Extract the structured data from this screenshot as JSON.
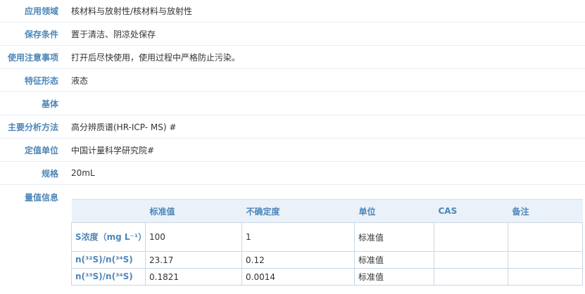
{
  "properties": [
    {
      "label": "应用领域",
      "value": "核材料与放射性/核材料与放射性"
    },
    {
      "label": "保存条件",
      "value": "置于清洁、阴凉处保存"
    },
    {
      "label": "使用注意事项",
      "value": "打开后尽快使用，使用过程中严格防止污染。"
    },
    {
      "label": "特征形态",
      "value": "液态"
    },
    {
      "label": "基体",
      "value": ""
    },
    {
      "label": "主要分析方法",
      "value": "高分辨质谱(HR-ICP- MS) #"
    },
    {
      "label": "定值单位",
      "value": "中国计量科学研究院#"
    },
    {
      "label": "规格",
      "value": "20mL"
    }
  ],
  "quantity": {
    "label": "量值信息",
    "headers": [
      "",
      "标准值",
      "不确定度",
      "单位",
      "CAS",
      "备注"
    ],
    "rows": [
      {
        "name": "S浓度（mg L⁻¹）",
        "value": "100",
        "uncertainty": "1",
        "unit": "标准值",
        "cas": "",
        "note": ""
      },
      {
        "name": "n(³²S)/n(³⁴S)",
        "value": "23.17",
        "uncertainty": "0.12",
        "unit": "标准值",
        "cas": "",
        "note": ""
      },
      {
        "name": "n(³³S)/n(³⁴S)",
        "value": "0.1821",
        "uncertainty": "0.0014",
        "unit": "标准值",
        "cas": "",
        "note": ""
      }
    ]
  }
}
